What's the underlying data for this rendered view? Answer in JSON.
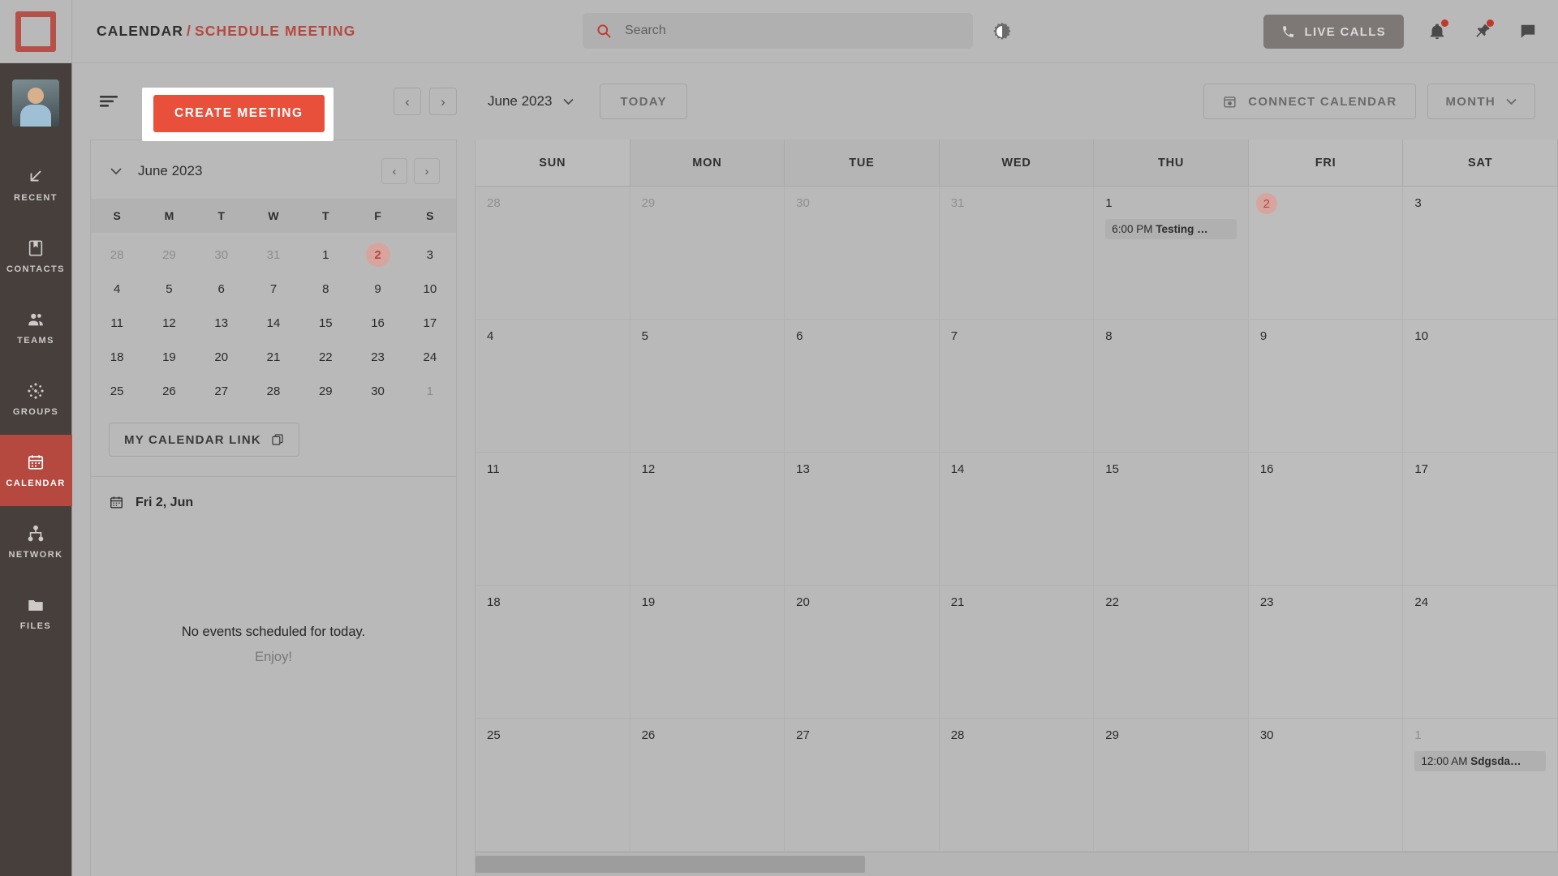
{
  "header": {
    "logo_icon": "app-logo",
    "breadcrumb": {
      "first": "CALENDAR",
      "separator": "/",
      "last": "SCHEDULE MEETING"
    },
    "search": {
      "placeholder": "Search",
      "value": "",
      "icon": "search-icon"
    },
    "theme_toggle_icon": "brightness-contrast-icon",
    "live_calls": {
      "label": "LIVE CALLS",
      "icon": "phone-icon"
    },
    "notifications_icon": "bell-icon",
    "pin_icon": "pin-icon",
    "chat_icon": "chat-icon",
    "has_notification_dot": true
  },
  "sidebar": {
    "avatar_name": "user-avatar",
    "items": [
      {
        "label": "RECENT",
        "icon": "arrow-down-left-icon",
        "active": false
      },
      {
        "label": "CONTACTS",
        "icon": "address-book-icon",
        "active": false
      },
      {
        "label": "TEAMS",
        "icon": "people-icon",
        "active": false
      },
      {
        "label": "GROUPS",
        "icon": "dotted-circle-icon",
        "active": false
      },
      {
        "label": "CALENDAR",
        "icon": "calendar-icon",
        "active": true
      },
      {
        "label": "NETWORK",
        "icon": "network-nodes-icon",
        "active": false
      },
      {
        "label": "FILES",
        "icon": "folder-icon",
        "active": false
      }
    ]
  },
  "toolbar": {
    "filter_icon": "filter-lines-icon",
    "create_meeting_label": "CREATE MEETING",
    "create_meeting_highlighted": true,
    "prev_label": "‹",
    "next_label": "›",
    "month_label": "June 2023",
    "month_caret": "∨",
    "today_label": "TODAY",
    "connect_calendar_label": "CONNECT CALENDAR",
    "connect_calendar_icon": "calendar-plus-icon",
    "view_label": "MONTH",
    "view_caret": "∨"
  },
  "left_panel": {
    "collapse_icon": "chevron-down-icon",
    "mini_title": "June 2023",
    "prev_label": "‹",
    "next_label": "›",
    "dow": [
      "S",
      "M",
      "T",
      "W",
      "T",
      "F",
      "S"
    ],
    "mini_weeks": [
      [
        {
          "d": "28",
          "m": true
        },
        {
          "d": "29",
          "m": true
        },
        {
          "d": "30",
          "m": true
        },
        {
          "d": "31",
          "m": true
        },
        {
          "d": "1"
        },
        {
          "d": "2",
          "today": true
        },
        {
          "d": "3"
        }
      ],
      [
        {
          "d": "4"
        },
        {
          "d": "5"
        },
        {
          "d": "6"
        },
        {
          "d": "7"
        },
        {
          "d": "8"
        },
        {
          "d": "9"
        },
        {
          "d": "10"
        }
      ],
      [
        {
          "d": "11"
        },
        {
          "d": "12"
        },
        {
          "d": "13"
        },
        {
          "d": "14"
        },
        {
          "d": "15"
        },
        {
          "d": "16"
        },
        {
          "d": "17"
        }
      ],
      [
        {
          "d": "18"
        },
        {
          "d": "19"
        },
        {
          "d": "20"
        },
        {
          "d": "21"
        },
        {
          "d": "22"
        },
        {
          "d": "23"
        },
        {
          "d": "24"
        }
      ],
      [
        {
          "d": "25"
        },
        {
          "d": "26"
        },
        {
          "d": "27"
        },
        {
          "d": "28"
        },
        {
          "d": "29"
        },
        {
          "d": "30"
        },
        {
          "d": "1",
          "m": true
        }
      ]
    ],
    "calendar_link_label": "MY CALENDAR LINK",
    "calendar_link_icon": "copy-icon",
    "selected_day_icon": "calendar-small-icon",
    "selected_day_label": "Fri 2, Jun",
    "empty_main": "No events scheduled for today.",
    "empty_sub": "Enjoy!"
  },
  "calendar": {
    "day_headers": [
      "SUN",
      "MON",
      "TUE",
      "WED",
      "THU",
      "FRI",
      "SAT"
    ],
    "weeks": [
      [
        {
          "num": "28",
          "other": true
        },
        {
          "num": "29",
          "other": true
        },
        {
          "num": "30",
          "other": true
        },
        {
          "num": "31",
          "other": true
        },
        {
          "num": "1",
          "events": [
            {
              "time": "6:00 PM",
              "title": "Testing …"
            }
          ]
        },
        {
          "num": "2",
          "today": true
        },
        {
          "num": "3"
        }
      ],
      [
        {
          "num": "4"
        },
        {
          "num": "5"
        },
        {
          "num": "6"
        },
        {
          "num": "7"
        },
        {
          "num": "8"
        },
        {
          "num": "9"
        },
        {
          "num": "10"
        }
      ],
      [
        {
          "num": "11"
        },
        {
          "num": "12"
        },
        {
          "num": "13"
        },
        {
          "num": "14"
        },
        {
          "num": "15"
        },
        {
          "num": "16"
        },
        {
          "num": "17"
        }
      ],
      [
        {
          "num": "18"
        },
        {
          "num": "19"
        },
        {
          "num": "20"
        },
        {
          "num": "21"
        },
        {
          "num": "22"
        },
        {
          "num": "23"
        },
        {
          "num": "24"
        }
      ],
      [
        {
          "num": "25"
        },
        {
          "num": "26"
        },
        {
          "num": "27"
        },
        {
          "num": "28"
        },
        {
          "num": "29"
        },
        {
          "num": "30"
        },
        {
          "num": "1",
          "other": true,
          "events": [
            {
              "time": "12:00 AM",
              "title": "Sdgsda…"
            }
          ]
        }
      ]
    ]
  },
  "colors": {
    "accent_red": "#b5493f",
    "create_button_red": "#e8503c",
    "sidebar_dark": "#463f3c",
    "page_bg": "#b9b9b9"
  }
}
